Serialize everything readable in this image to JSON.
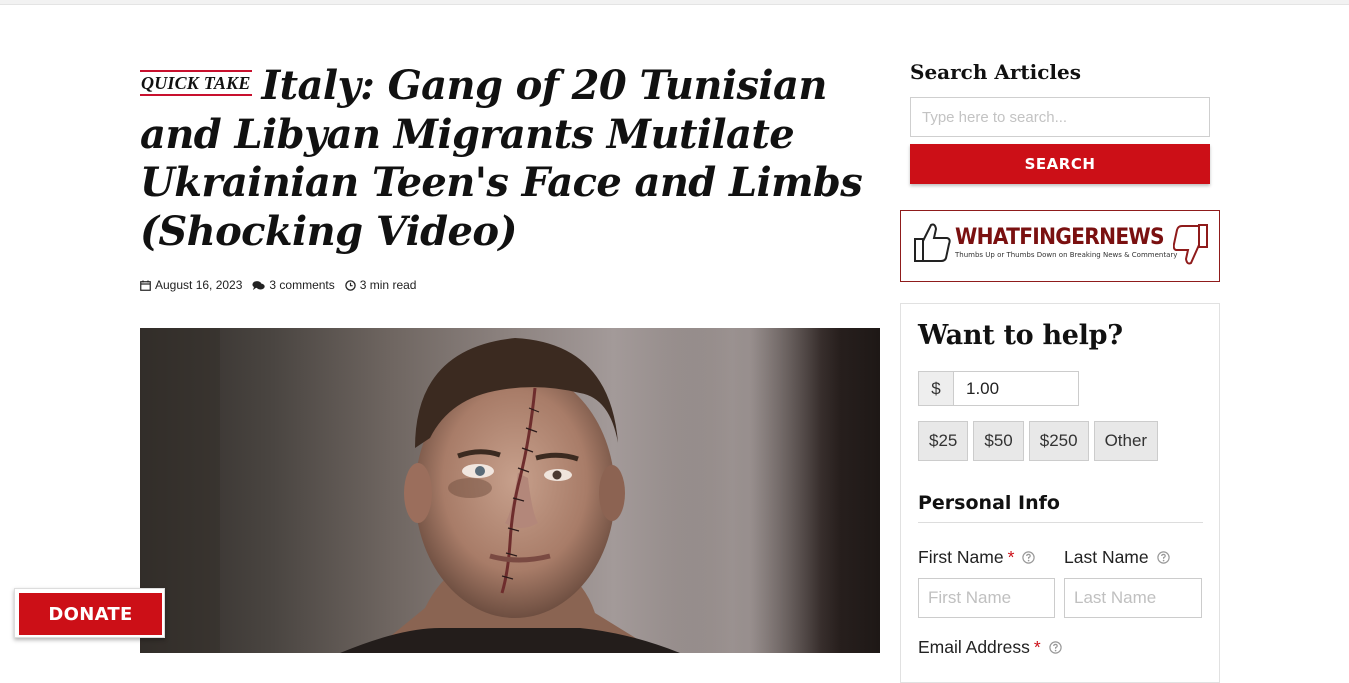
{
  "article": {
    "badge": "QUICK TAKE",
    "title": "Italy: Gang of 20 Tunisian and Libyan Migrants Mutilate Ukrainian Teen's Face and Limbs (Shocking Video)",
    "date": "August 16, 2023",
    "comments": "3 comments",
    "read_time": "3 min read",
    "hero_image_alt": "Photo of a young man with stitched scar across his face"
  },
  "sidebar": {
    "search": {
      "title": "Search Articles",
      "placeholder": "Type here to search...",
      "button_label": "SEARCH"
    },
    "ad": {
      "brand": "WHATFINGERNEWS",
      "tagline": "Thumbs Up or Thumbs Down on Breaking News & Commentary",
      "brand_color": "#7a1010"
    },
    "donate_form": {
      "title": "Want to help?",
      "currency_symbol": "$",
      "amount": "1.00",
      "levels": [
        "$25",
        "$50",
        "$250",
        "Other"
      ],
      "personal_info_title": "Personal Info",
      "first_name_label": "First Name",
      "last_name_label": "Last Name",
      "email_label": "Email Address",
      "required_mark": "*",
      "first_name_placeholder": "First Name",
      "last_name_placeholder": "Last Name"
    }
  },
  "floating_donate": {
    "label": "DONATE"
  },
  "colors": {
    "accent_red": "#cc0f17",
    "badge_rule": "#c8102e"
  }
}
